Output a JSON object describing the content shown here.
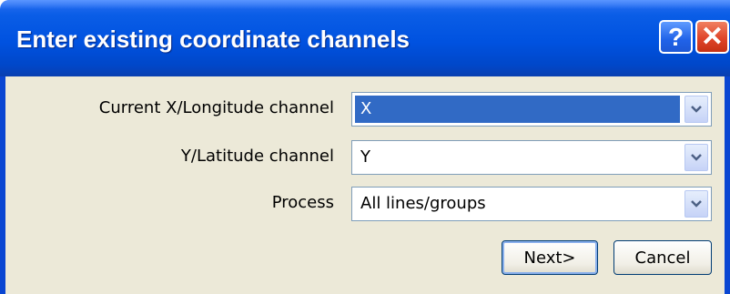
{
  "window": {
    "title": "Enter existing coordinate channels",
    "help_label": "?",
    "close_label": "✕"
  },
  "form": {
    "x_label": "Current X/Longitude channel",
    "x_value": "X",
    "y_label": "Y/Latitude channel",
    "y_value": "Y",
    "process_label": "Process",
    "process_value": "All lines/groups"
  },
  "buttons": {
    "next": "Next>",
    "cancel": "Cancel"
  },
  "icons": {
    "dropdown": "chevron-down-icon",
    "help": "question-icon",
    "close": "close-icon"
  },
  "colors": {
    "titlebar": "#0052e0",
    "selection": "#316ac5",
    "client": "#ece9d8",
    "close": "#e0452a"
  }
}
